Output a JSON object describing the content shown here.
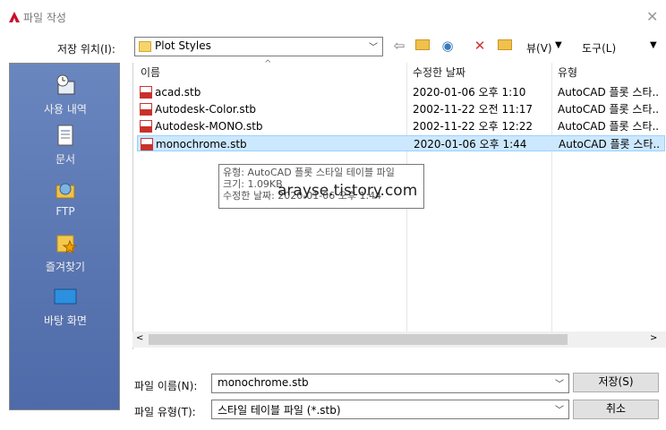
{
  "title": "파일 작성",
  "save_in": {
    "label": "저장 위치(I):",
    "value": "Plot Styles"
  },
  "toolbar": {
    "view_label": "뷰(V)",
    "tools_label": "도구(L)"
  },
  "places": [
    {
      "label": "사용 내역",
      "icon": "history-icon"
    },
    {
      "label": "문서",
      "icon": "documents-icon"
    },
    {
      "label": "FTP",
      "icon": "ftp-icon"
    },
    {
      "label": "즐겨찾기",
      "icon": "favorites-icon"
    },
    {
      "label": "바탕 화면",
      "icon": "desktop-icon"
    }
  ],
  "columns": {
    "name": "이름",
    "modified": "수정한 날짜",
    "type": "유형"
  },
  "files": [
    {
      "name": "acad.stb",
      "modified": "2020-01-06 오후 1:10",
      "type": "AutoCAD 플롯 스타.."
    },
    {
      "name": "Autodesk-Color.stb",
      "modified": "2002-11-22 오전 11:17",
      "type": "AutoCAD 플롯 스타.."
    },
    {
      "name": "Autodesk-MONO.stb",
      "modified": "2002-11-22 오후 12:22",
      "type": "AutoCAD 플롯 스타.."
    },
    {
      "name": "monochrome.stb",
      "modified": "2020-01-06 오후 1:44",
      "type": "AutoCAD 플롯 스타.."
    }
  ],
  "tooltip": {
    "type": "유형: AutoCAD 플롯 스타일 테이블 파일",
    "size": "크기: 1.09KB",
    "modified": "수정한 날짜: 2020-01-06 오후 1:44"
  },
  "watermark": "arayse.tistory.com",
  "filename": {
    "label": "파일 이름(N):",
    "value": "monochrome.stb"
  },
  "filetype": {
    "label": "파일 유형(T):",
    "value": "스타일 테이블 파일 (*.stb)"
  },
  "buttons": {
    "save": "저장(S)",
    "cancel": "취소"
  }
}
